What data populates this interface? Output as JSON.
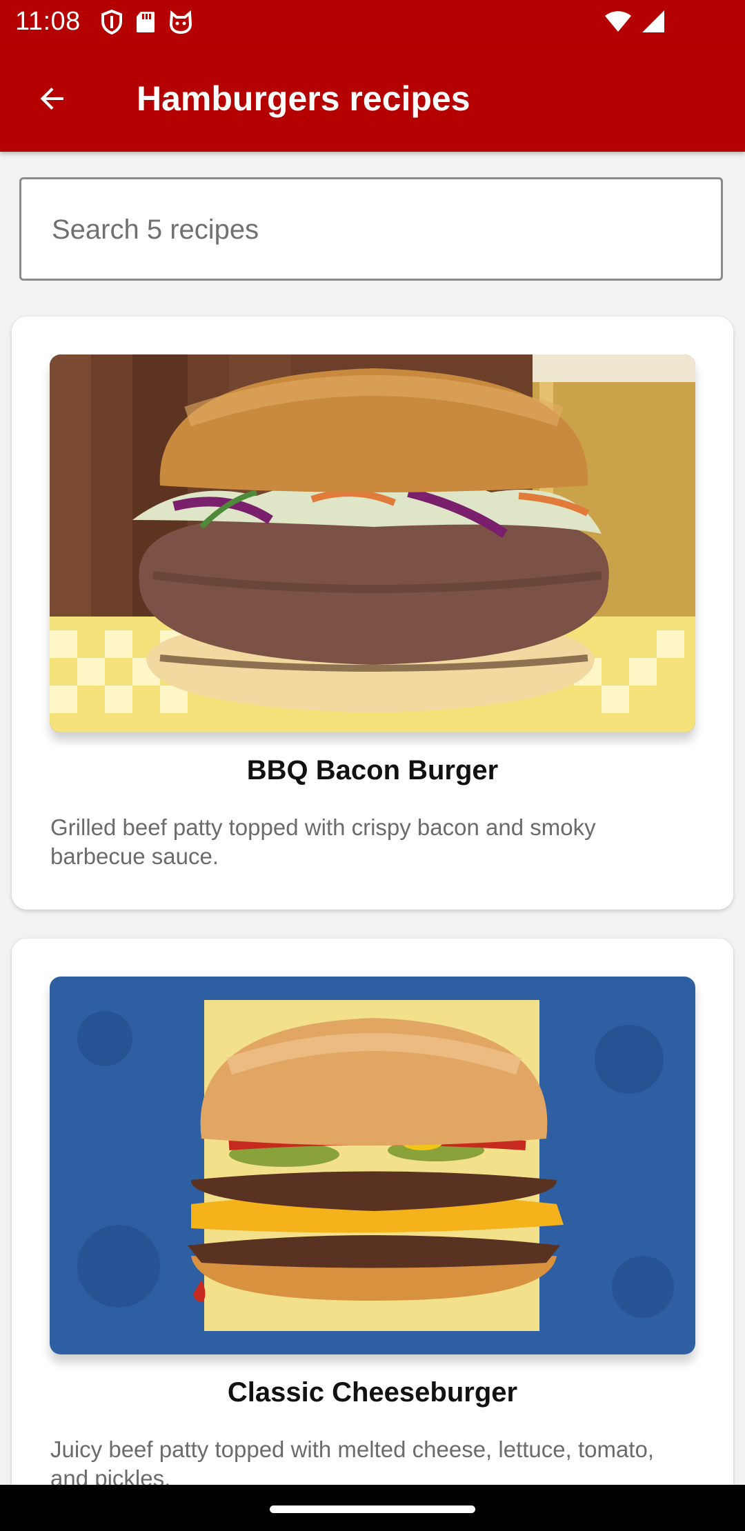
{
  "status_bar": {
    "time": "11:08",
    "left_icons": [
      "shield-icon",
      "sd-card-icon",
      "cat-face-icon"
    ],
    "right_icons": [
      "wifi-icon",
      "cell-signal-icon"
    ]
  },
  "app_bar": {
    "back_icon": "arrow-back-icon",
    "title": "Hamburgers recipes"
  },
  "search": {
    "placeholder": "Search 5 recipes",
    "value": ""
  },
  "recipes": [
    {
      "title": "BBQ Bacon Burger",
      "description": "Grilled beef patty topped with crispy bacon and smoky barbecue sauce."
    },
    {
      "title": "Classic Cheeseburger",
      "description": "Juicy beef patty topped with melted cheese, lettuce, tomato, and pickles."
    }
  ],
  "colors": {
    "brand_red": "#b50000",
    "background": "#f2f2f2",
    "card": "#ffffff"
  }
}
